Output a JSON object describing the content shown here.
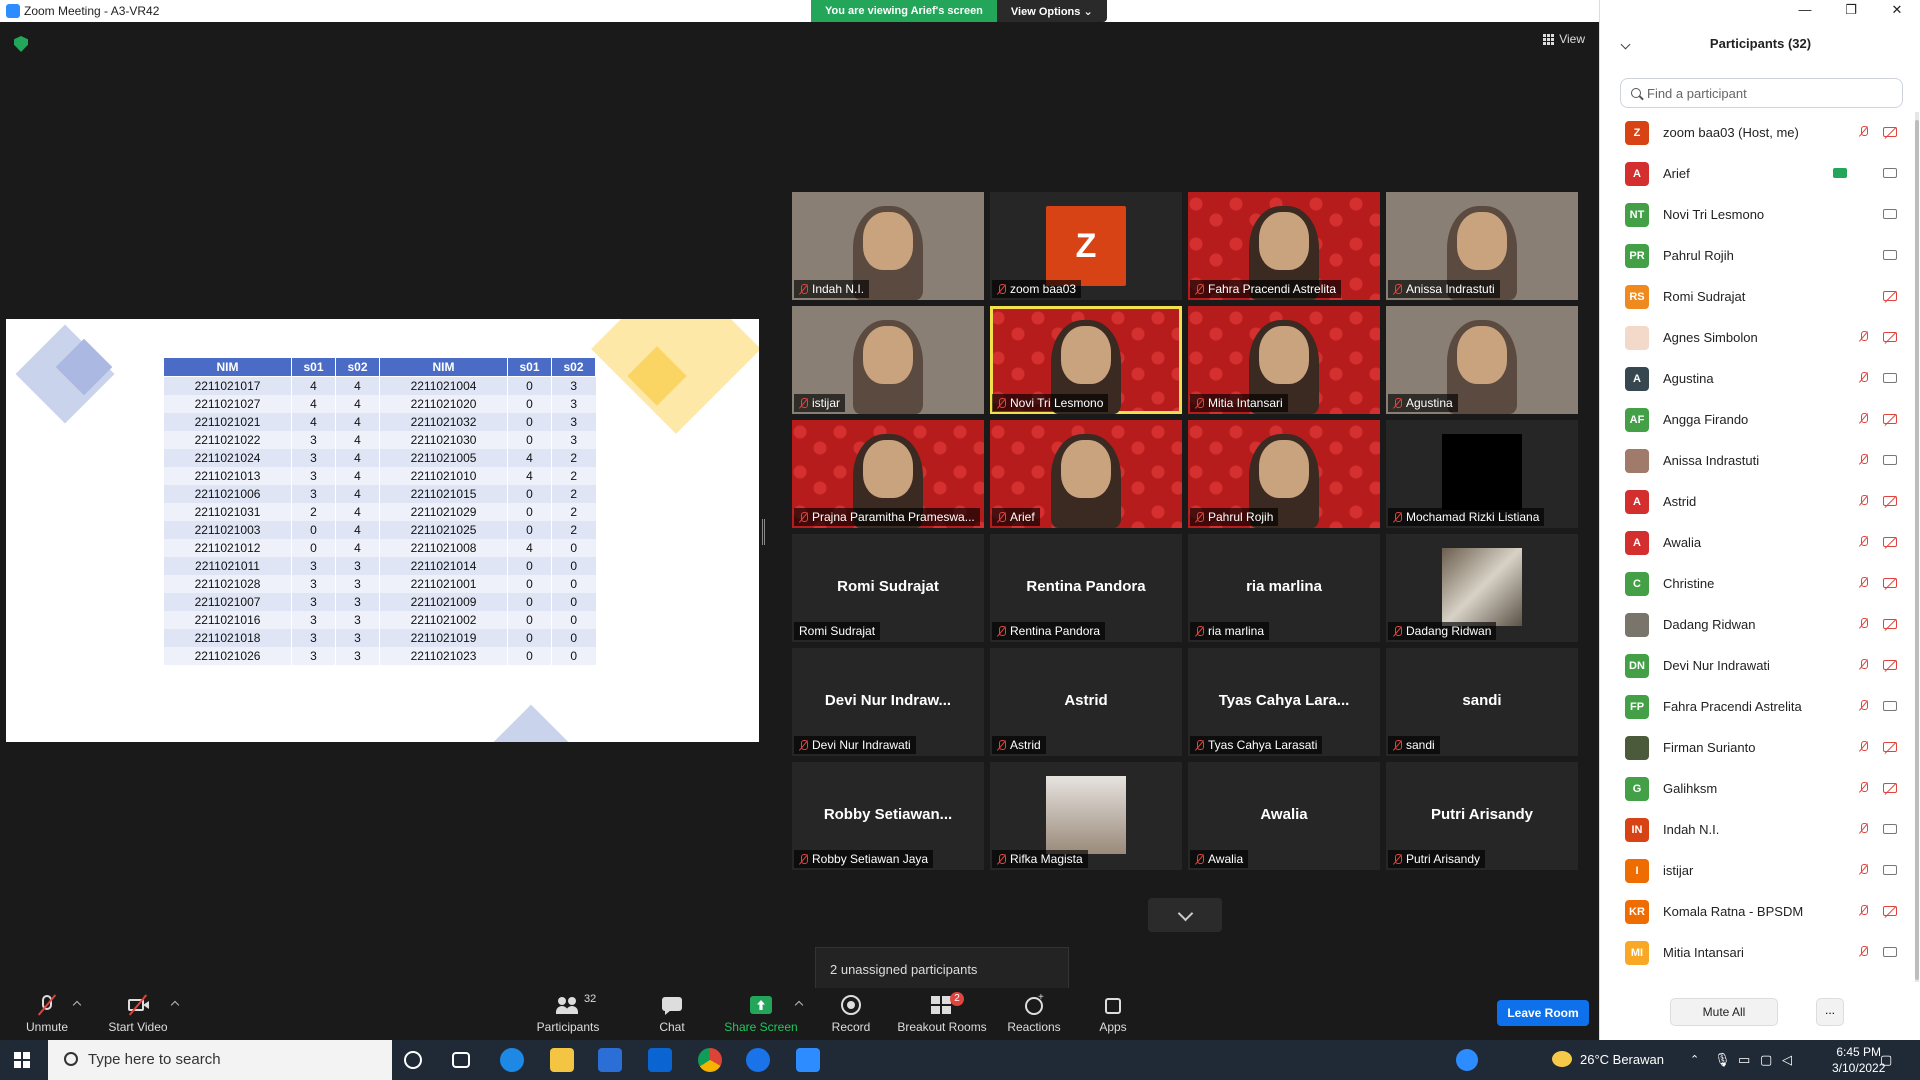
{
  "window": {
    "title": "Zoom Meeting - A3-VR42",
    "minimize": "—",
    "maximize": "❐",
    "close": "✕"
  },
  "banner": {
    "viewing": "You are viewing Arief's screen",
    "view_options": "View Options ⌄"
  },
  "view_button": "View",
  "slide": {
    "headers": [
      "NIM",
      "s01",
      "s02",
      "NIM",
      "s01",
      "s02"
    ],
    "rows": [
      [
        "2211021017",
        "4",
        "4",
        "2211021004",
        "0",
        "3"
      ],
      [
        "2211021027",
        "4",
        "4",
        "2211021020",
        "0",
        "3"
      ],
      [
        "2211021021",
        "4",
        "4",
        "2211021032",
        "0",
        "3"
      ],
      [
        "2211021022",
        "3",
        "4",
        "2211021030",
        "0",
        "3"
      ],
      [
        "2211021024",
        "3",
        "4",
        "2211021005",
        "4",
        "2"
      ],
      [
        "2211021013",
        "3",
        "4",
        "2211021010",
        "4",
        "2"
      ],
      [
        "2211021006",
        "3",
        "4",
        "2211021015",
        "0",
        "2"
      ],
      [
        "2211021031",
        "2",
        "4",
        "2211021029",
        "0",
        "2"
      ],
      [
        "2211021003",
        "0",
        "4",
        "2211021025",
        "0",
        "2"
      ],
      [
        "2211021012",
        "0",
        "4",
        "2211021008",
        "4",
        "0"
      ],
      [
        "2211021011",
        "3",
        "3",
        "2211021014",
        "0",
        "0"
      ],
      [
        "2211021028",
        "3",
        "3",
        "2211021001",
        "0",
        "0"
      ],
      [
        "2211021007",
        "3",
        "3",
        "2211021009",
        "0",
        "0"
      ],
      [
        "2211021016",
        "3",
        "3",
        "2211021002",
        "0",
        "0"
      ],
      [
        "2211021018",
        "3",
        "3",
        "2211021019",
        "0",
        "0"
      ],
      [
        "2211021026",
        "3",
        "3",
        "2211021023",
        "0",
        "0"
      ]
    ]
  },
  "gallery": [
    {
      "name": "Indah N.I.",
      "kind": "cam"
    },
    {
      "name": "zoom baa03",
      "kind": "avatar",
      "initial": "Z"
    },
    {
      "name": "Fahra Pracendi Astrelita",
      "kind": "red"
    },
    {
      "name": "Anissa Indrastuti",
      "kind": "cam"
    },
    {
      "name": "istijar",
      "kind": "cam"
    },
    {
      "name": "Novi Tri Lesmono",
      "kind": "red",
      "active": true
    },
    {
      "name": "Mitia Intansari",
      "kind": "red"
    },
    {
      "name": "Agustina",
      "kind": "cam"
    },
    {
      "name": "Prajna Paramitha Prameswari",
      "short": "Prajna Paramitha Prameswa...",
      "kind": "red"
    },
    {
      "name": "Arief",
      "kind": "red"
    },
    {
      "name": "Pahrul Rojih",
      "kind": "red"
    },
    {
      "name": "Mochamad Rizki Listiana",
      "kind": "black"
    },
    {
      "name": "Romi Sudrajat",
      "center": "Romi Sudrajat",
      "kind": "text",
      "mic_on": true
    },
    {
      "name": "Rentina Pandora",
      "center": "Rentina Pandora",
      "kind": "text"
    },
    {
      "name": "ria marlina",
      "center": "ria marlina",
      "kind": "text"
    },
    {
      "name": "Dadang Ridwan",
      "kind": "photo"
    },
    {
      "name": "Devi Nur Indrawati",
      "center": "Devi Nur Indraw...",
      "kind": "text"
    },
    {
      "name": "Astrid",
      "center": "Astrid",
      "kind": "text"
    },
    {
      "name": "Tyas Cahya Larasati",
      "center": "Tyas Cahya Lara...",
      "kind": "text"
    },
    {
      "name": "sandi",
      "center": "sandi",
      "kind": "text"
    },
    {
      "name": "Robby Setiawan Jaya",
      "center": "Robby Setiawan...",
      "kind": "text"
    },
    {
      "name": "Rifka Magista",
      "kind": "photo"
    },
    {
      "name": "Awalia",
      "center": "Awalia",
      "kind": "text"
    },
    {
      "name": "Putri Arisandy",
      "center": "Putri Arisandy",
      "kind": "text"
    }
  ],
  "unassigned": "2 unassigned participants",
  "toolbar": {
    "unmute": "Unmute",
    "start_video": "Start Video",
    "participants": "Participants",
    "participants_count": "32",
    "chat": "Chat",
    "share_screen": "Share Screen",
    "record": "Record",
    "breakout_rooms": "Breakout Rooms",
    "breakout_badge": "2",
    "reactions": "Reactions",
    "apps": "Apps",
    "leave": "Leave Room"
  },
  "panel": {
    "title": "Participants (32)",
    "search_placeholder": "Find a participant",
    "mute_all": "Mute All",
    "more": "...",
    "participants": [
      {
        "name": "zoom baa03 (Host, me)",
        "initials": "Z",
        "color": "#d84315",
        "mic": "off",
        "cam": "off"
      },
      {
        "name": "Arief",
        "initials": "A",
        "color": "#d32f2f",
        "mic": "on",
        "cam": "plain",
        "sharing": true
      },
      {
        "name": "Novi Tri Lesmono",
        "initials": "NT",
        "color": "#43a047",
        "mic": "on",
        "cam": "plain"
      },
      {
        "name": "Pahrul Rojih",
        "initials": "PR",
        "color": "#43a047",
        "mic": "on",
        "cam": "plain"
      },
      {
        "name": "Romi Sudrajat",
        "initials": "RS",
        "color": "#ef8a1f",
        "mic": "on",
        "cam": "off"
      },
      {
        "name": "Agnes Simbolon",
        "initials": "",
        "color": "#f3d9c9",
        "mic": "off",
        "cam": "off"
      },
      {
        "name": "Agustina",
        "initials": "A",
        "color": "#37474f",
        "mic": "off",
        "cam": "plain"
      },
      {
        "name": "Angga Firando",
        "initials": "AF",
        "color": "#43a047",
        "mic": "off",
        "cam": "off"
      },
      {
        "name": "Anissa Indrastuti",
        "initials": "",
        "color": "#a07a6a",
        "mic": "off",
        "cam": "plain"
      },
      {
        "name": "Astrid",
        "initials": "A",
        "color": "#d32f2f",
        "mic": "off",
        "cam": "off"
      },
      {
        "name": "Awalia",
        "initials": "A",
        "color": "#d32f2f",
        "mic": "off",
        "cam": "off"
      },
      {
        "name": "Christine",
        "initials": "C",
        "color": "#43a047",
        "mic": "off",
        "cam": "off"
      },
      {
        "name": "Dadang Ridwan",
        "initials": "",
        "color": "#7a756a",
        "mic": "off",
        "cam": "off"
      },
      {
        "name": "Devi Nur Indrawati",
        "initials": "DN",
        "color": "#43a047",
        "mic": "off",
        "cam": "off"
      },
      {
        "name": "Fahra Pracendi Astrelita",
        "initials": "FP",
        "color": "#43a047",
        "mic": "off",
        "cam": "plain"
      },
      {
        "name": "Firman Surianto",
        "initials": "",
        "color": "#4a5a3a",
        "mic": "off",
        "cam": "off"
      },
      {
        "name": "Galihksm",
        "initials": "G",
        "color": "#43a047",
        "mic": "off",
        "cam": "off"
      },
      {
        "name": "Indah N.I.",
        "initials": "IN",
        "color": "#d84315",
        "mic": "off",
        "cam": "plain"
      },
      {
        "name": "istijar",
        "initials": "I",
        "color": "#ef6c00",
        "mic": "off",
        "cam": "plain"
      },
      {
        "name": "Komala Ratna - BPSDM",
        "initials": "KR",
        "color": "#ef6c00",
        "mic": "off",
        "cam": "off"
      },
      {
        "name": "Mitia Intansari",
        "initials": "MI",
        "color": "#f9a825",
        "mic": "off",
        "cam": "plain"
      }
    ]
  },
  "taskbar": {
    "search": "Type here to search",
    "weather": "26°C  Berawan",
    "time": "6:45 PM",
    "date": "3/10/2022"
  }
}
